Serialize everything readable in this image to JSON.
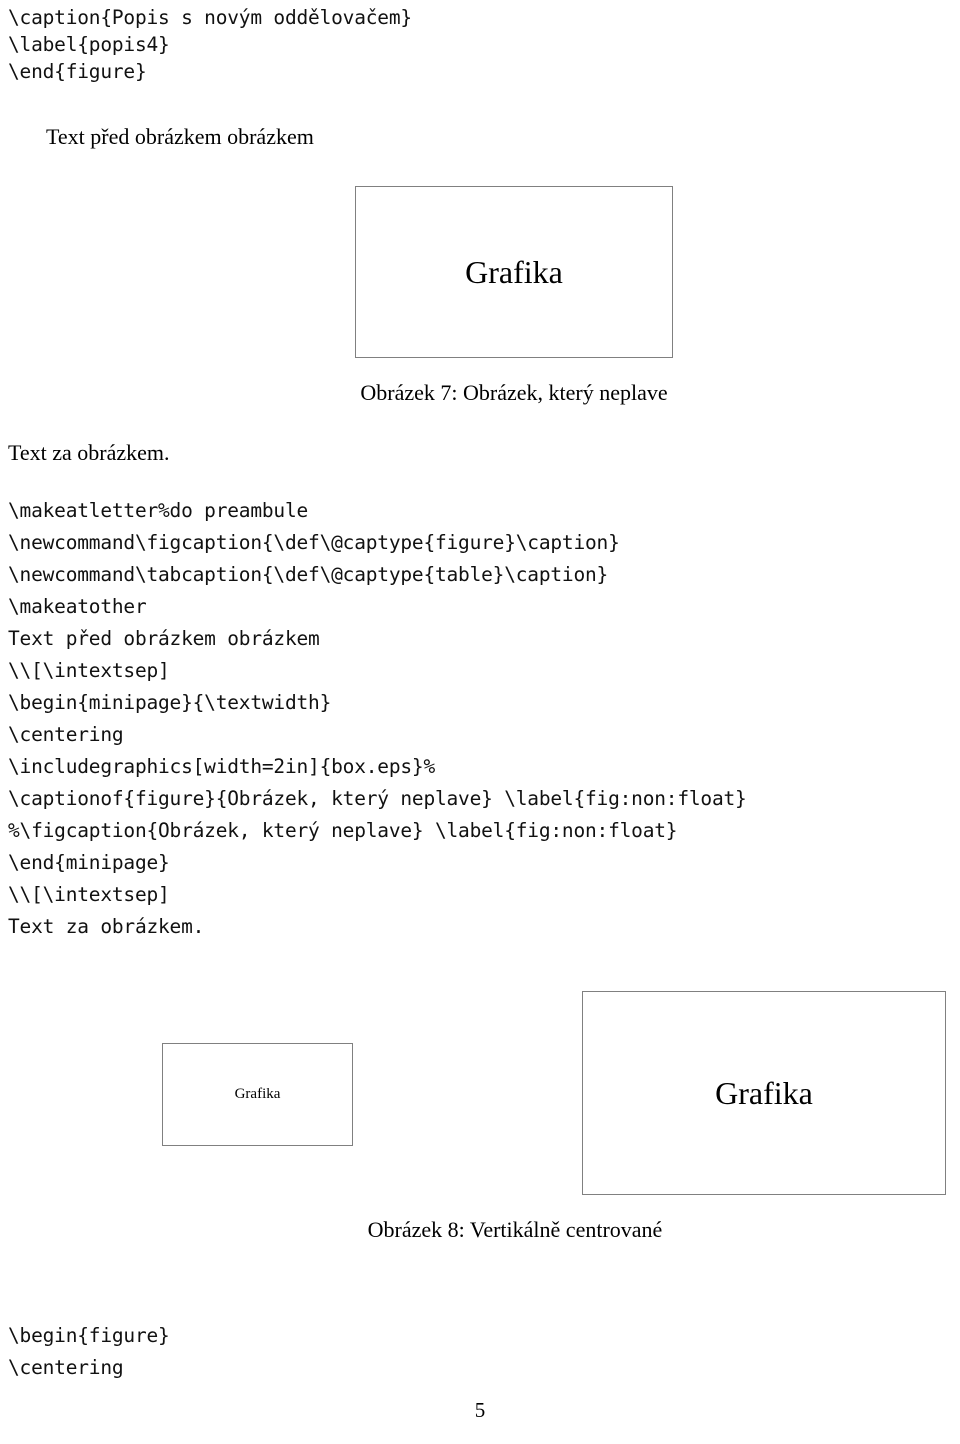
{
  "document": {
    "page_number": "5",
    "language": "cs"
  },
  "code_block_top": {
    "lines": [
      "\\caption{Popis s novým oddělovačem}",
      "\\label{popis4}",
      "\\end{figure}"
    ]
  },
  "prose_before_figure7": "Text před obrázkem obrázkem",
  "figure7": {
    "graphic_label": "Grafika",
    "caption": "Obrázek 7: Obrázek, který neplave"
  },
  "prose_after_figure7": "Text za obrázkem.",
  "code_block_main": {
    "lines": [
      "\\makeatletter%do preambule",
      "\\newcommand\\figcaption{\\def\\@captype{figure}\\caption}",
      "\\newcommand\\tabcaption{\\def\\@captype{table}\\caption}",
      "\\makeatother",
      "Text před obrázkem obrázkem",
      "\\\\[\\intextsep]",
      "\\begin{minipage}{\\textwidth}",
      "\\centering",
      "\\includegraphics[width=2in]{box.eps}%",
      "\\captionof{figure}{Obrázek, který neplave} \\label{fig:non:float}",
      "%\\figcaption{Obrázek, který neplave} \\label{fig:non:float}",
      "\\end{minipage}",
      "\\\\[\\intextsep]",
      "Text za obrázkem."
    ]
  },
  "figure8": {
    "graphic_label_small": "Grafika",
    "graphic_label_large": "Grafika",
    "caption": "Obrázek 8: Vertikálně centrované"
  },
  "code_block_bottom": {
    "lines": [
      "\\begin{figure}",
      "\\centering"
    ]
  }
}
